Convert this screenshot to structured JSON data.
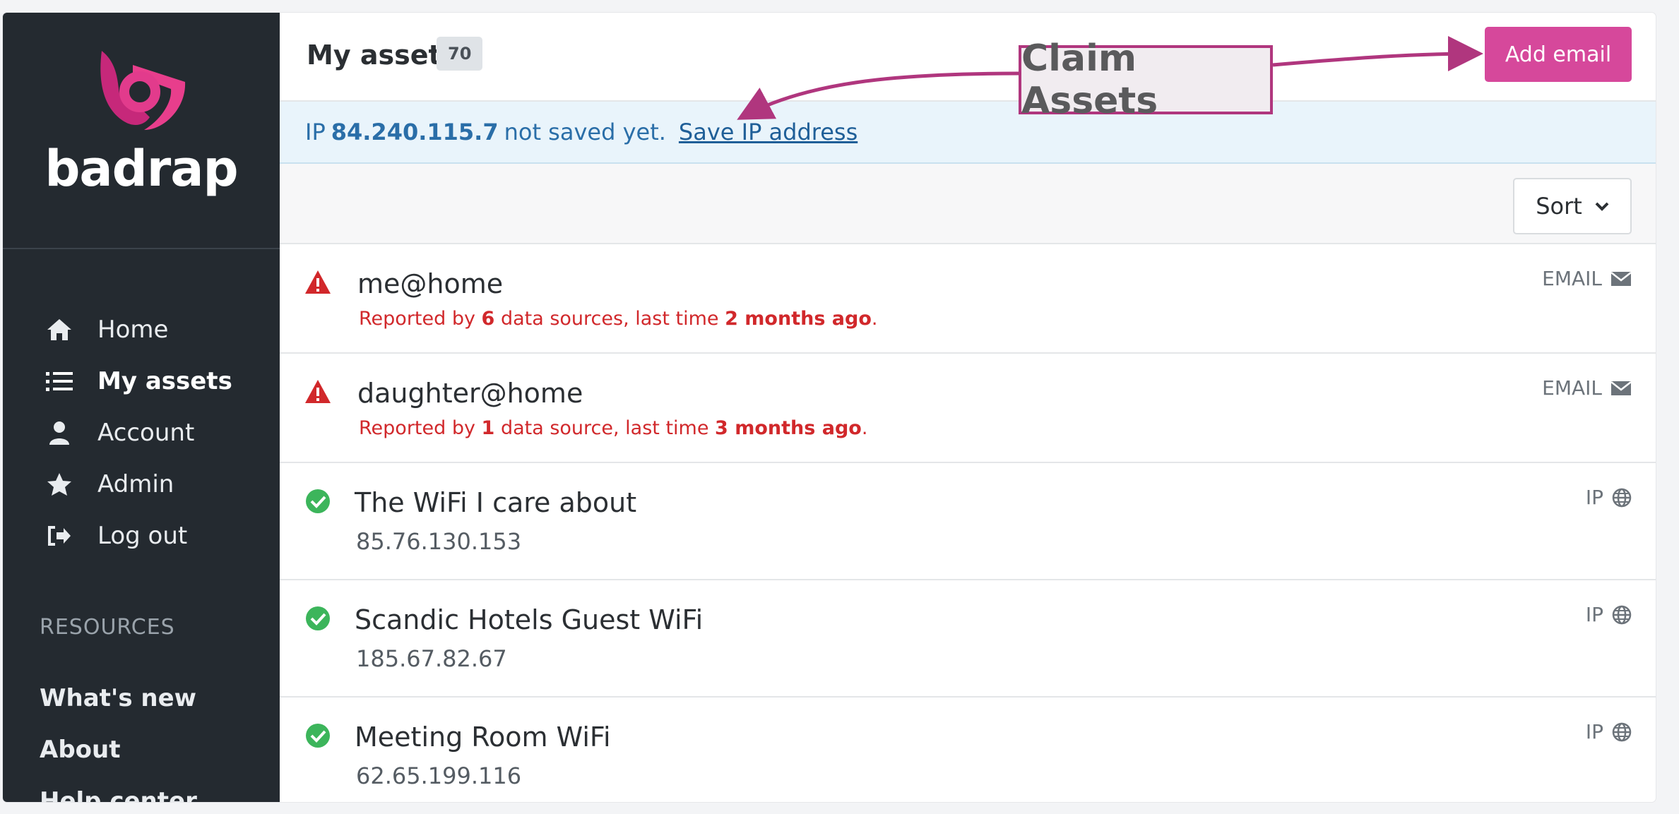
{
  "brand": {
    "name": "badrap",
    "accent": "#d6489b",
    "logo_primary": "#c6287a",
    "logo_secondary": "#e83e8c"
  },
  "sidebar": {
    "items": [
      {
        "label": "Home",
        "icon": "home-icon"
      },
      {
        "label": "My assets",
        "icon": "list-icon",
        "active": true
      },
      {
        "label": "Account",
        "icon": "user-icon"
      },
      {
        "label": "Admin",
        "icon": "star-icon"
      },
      {
        "label": "Log out",
        "icon": "sign-out-icon"
      }
    ],
    "resources_title": "RESOURCES",
    "resources": [
      "What's new",
      "About",
      "Help center"
    ]
  },
  "header": {
    "title": "My assets",
    "count": "70",
    "add_label": "Add email"
  },
  "notice": {
    "prefix": "IP",
    "ip": "84.240.115.7",
    "suffix": "not saved yet.",
    "link": "Save IP address"
  },
  "sort": {
    "label": "Sort"
  },
  "assets": [
    {
      "name": "me@home",
      "type": "EMAIL",
      "status": "warning",
      "sub_pre": "Reported by",
      "sub_count": "6",
      "sub_mid": "data sources, last time",
      "sub_time": "2 months ago",
      "sub_end": "."
    },
    {
      "name": "daughter@home",
      "type": "EMAIL",
      "status": "warning",
      "sub_pre": "Reported by",
      "sub_count": "1",
      "sub_mid": "data source, last time",
      "sub_time": "3 months ago",
      "sub_end": "."
    },
    {
      "name": "The WiFi I care about",
      "type": "IP",
      "status": "ok",
      "address": "85.76.130.153"
    },
    {
      "name": "Scandic Hotels Guest WiFi",
      "type": "IP",
      "status": "ok",
      "address": "185.67.82.67"
    },
    {
      "name": "Meeting Room WiFi",
      "type": "IP",
      "status": "ok",
      "address": "62.65.199.116"
    }
  ],
  "annotation": {
    "label": "Claim Assets",
    "color": "#b0367e"
  }
}
